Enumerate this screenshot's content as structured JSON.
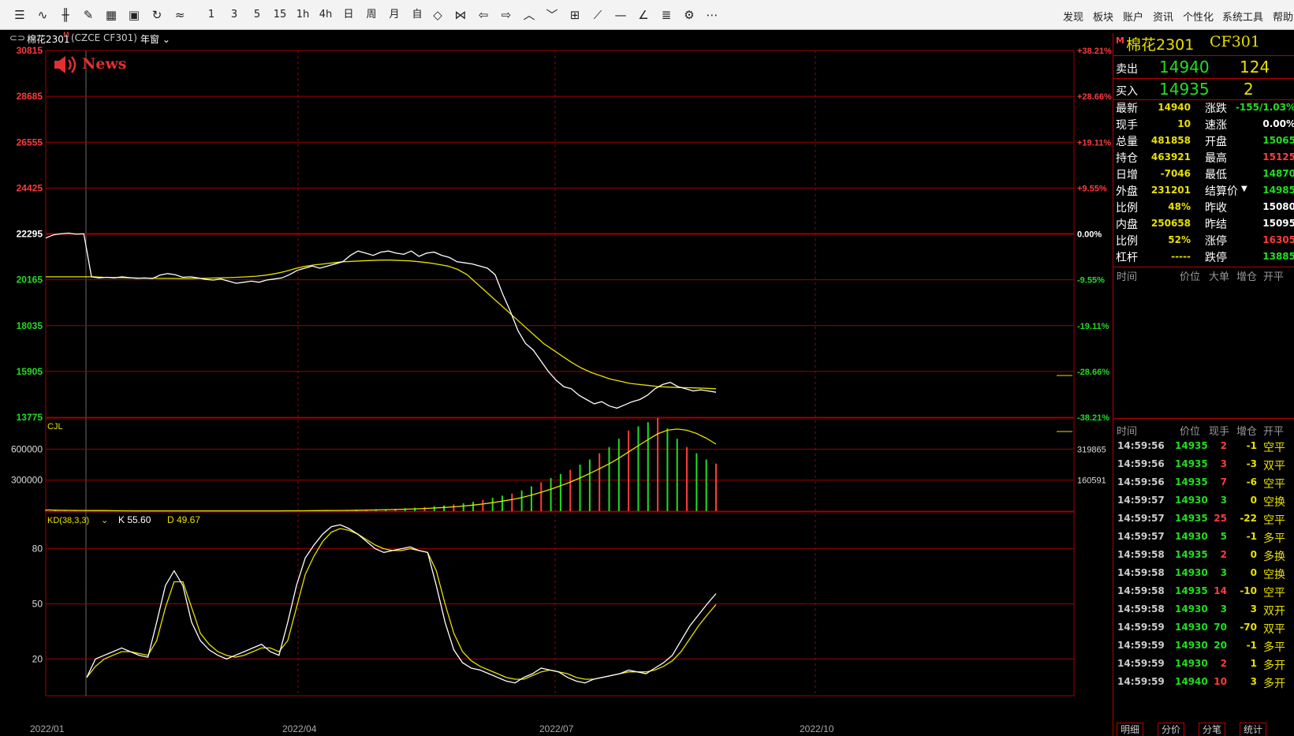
{
  "toolbar": {
    "buttons": [
      {
        "icon": "list-icon",
        "glyph": "☰"
      },
      {
        "icon": "line-chart-icon",
        "glyph": "∿"
      },
      {
        "icon": "candle-icon",
        "glyph": "╫"
      },
      {
        "icon": "draw-icon",
        "glyph": "✎"
      },
      {
        "icon": "grid-icon",
        "glyph": "▦"
      },
      {
        "icon": "save-icon",
        "glyph": "▣"
      },
      {
        "icon": "refresh-icon",
        "glyph": "↻"
      },
      {
        "icon": "wave-icon",
        "glyph": "≈"
      }
    ],
    "periods": [
      "1",
      "3",
      "5",
      "15",
      "1h",
      "4h",
      "日",
      "周",
      "月",
      "自"
    ],
    "tools": [
      {
        "icon": "zoom-in-icon",
        "glyph": "◇"
      },
      {
        "icon": "zoom-out-icon",
        "glyph": "⋈"
      },
      {
        "icon": "arrow-left-icon",
        "glyph": "⇦"
      },
      {
        "icon": "arrow-right-icon",
        "glyph": "⇨"
      },
      {
        "icon": "chevron-up-icon",
        "glyph": "︿"
      },
      {
        "icon": "chevron-down-icon",
        "glyph": "﹀"
      },
      {
        "icon": "layout-icon",
        "glyph": "⊞"
      },
      {
        "icon": "diagonal-line-icon",
        "glyph": "⟋"
      },
      {
        "icon": "horizontal-line-icon",
        "glyph": "—"
      },
      {
        "icon": "angle-icon",
        "glyph": "∠"
      },
      {
        "icon": "text-icon",
        "glyph": "≣"
      },
      {
        "icon": "settings-icon",
        "glyph": "⚙"
      },
      {
        "icon": "more-icon",
        "glyph": "⋯"
      }
    ],
    "menu": [
      "发现",
      "板块",
      "账户",
      "资讯",
      "个性化",
      "系统工具",
      "帮助"
    ]
  },
  "chart_header": {
    "name": "棉花2301",
    "marker": "M",
    "code": "(CZCE CF301)",
    "window": "年窗"
  },
  "news_label": "News",
  "colors": {
    "up": "#ff3b3b",
    "down": "#22dd22",
    "price_line": "#ffffff",
    "ma_line": "#e8e000",
    "grid": "#a00000",
    "label_yellow": "#e8e000"
  },
  "chart_data": {
    "type": "line",
    "x_labels": [
      "2022/01",
      "2022/04",
      "2022/07",
      "2022/10"
    ],
    "price_axis": {
      "left": [
        "30815",
        "28685",
        "26555",
        "24425",
        "22295",
        "20165",
        "18035",
        "15905",
        "13775"
      ],
      "right": [
        "+38.21%",
        "+28.66%",
        "+19.11%",
        "+9.55%",
        "0.00%",
        "-9.55%",
        "-19.11%",
        "-28.66%",
        "-38.21%"
      ],
      "ylim": [
        13775,
        30815
      ],
      "base": 22295
    },
    "price_series": [
      22100,
      22250,
      22300,
      22330,
      22280,
      22300,
      20300,
      20250,
      20280,
      20250,
      20300,
      20260,
      20230,
      20250,
      20220,
      20380,
      20450,
      20400,
      20280,
      20300,
      20250,
      20180,
      20150,
      20200,
      20100,
      20000,
      20050,
      20100,
      20050,
      20150,
      20200,
      20250,
      20400,
      20600,
      20700,
      20800,
      20700,
      20800,
      20900,
      21000,
      21300,
      21500,
      21400,
      21300,
      21450,
      21500,
      21400,
      21350,
      21500,
      21250,
      21400,
      21450,
      21300,
      21200,
      21000,
      20950,
      20900,
      20800,
      20700,
      20400,
      19500,
      18700,
      17800,
      17200,
      16900,
      16400,
      15900,
      15500,
      15200,
      15100,
      14800,
      14600,
      14400,
      14500,
      14300,
      14200,
      14350,
      14500,
      14600,
      14800,
      15100,
      15300,
      15400,
      15200,
      15100,
      15000,
      15050,
      15000,
      14940
    ],
    "ma_series": [
      20300,
      20300,
      20300,
      20300,
      20300,
      20300,
      20280,
      20270,
      20260,
      20250,
      20240,
      20240,
      20230,
      20230,
      20220,
      20220,
      20230,
      20240,
      20250,
      20260,
      20280,
      20300,
      20330,
      20380,
      20450,
      20550,
      20680,
      20780,
      20850,
      20900,
      20950,
      21000,
      21020,
      21040,
      21060,
      21080,
      21080,
      21060,
      21040,
      21000,
      20950,
      20880,
      20800,
      20650,
      20400,
      20000,
      19600,
      19200,
      18800,
      18400,
      18000,
      17600,
      17200,
      16900,
      16600,
      16300,
      16050,
      15850,
      15700,
      15550,
      15450,
      15350,
      15300,
      15250,
      15200,
      15180,
      15160,
      15150,
      15140,
      15120,
      15100
    ],
    "volume": {
      "label": "CJL",
      "axis_left": [
        "600000",
        "300000"
      ],
      "axis_right": [
        "319865",
        "160591"
      ],
      "ylim": [
        0,
        900000
      ],
      "values": [
        12000,
        8000,
        6000,
        5000,
        4000,
        3000,
        3000,
        3000,
        3000,
        3000,
        3000,
        3000,
        3000,
        3000,
        3000,
        3000,
        3000,
        3000,
        3000,
        3000,
        3000,
        3000,
        4000,
        4000,
        4000,
        5000,
        5000,
        6000,
        8000,
        9000,
        10000,
        12000,
        14000,
        16000,
        18000,
        20000,
        24000,
        28000,
        34000,
        40000,
        48000,
        56000,
        66000,
        76000,
        90000,
        110000,
        130000,
        150000,
        170000,
        200000,
        240000,
        280000,
        320000,
        360000,
        400000,
        450000,
        500000,
        560000,
        620000,
        700000,
        780000,
        820000,
        860000,
        900000,
        800000,
        700000,
        620000,
        560000,
        500000,
        460000
      ]
    },
    "kd": {
      "label": "KD(38,3,3)",
      "k_label": "K 55.60",
      "d_label": "D 49.67",
      "axis": [
        "80",
        "50",
        "20"
      ],
      "ylim": [
        0,
        100
      ],
      "k_series": [
        10,
        20,
        22,
        24,
        26,
        24,
        22,
        21,
        40,
        60,
        68,
        60,
        40,
        30,
        25,
        22,
        20,
        22,
        24,
        26,
        28,
        24,
        22,
        40,
        60,
        75,
        82,
        88,
        92,
        93,
        91,
        88,
        84,
        80,
        78,
        79,
        80,
        81,
        79,
        78,
        60,
        40,
        25,
        18,
        15,
        14,
        12,
        10,
        8,
        7,
        10,
        12,
        15,
        14,
        13,
        10,
        8,
        7,
        9,
        10,
        11,
        12,
        14,
        13,
        12,
        15,
        18,
        22,
        30,
        38,
        44,
        50,
        55.6
      ],
      "d_series": [
        10,
        16,
        20,
        22,
        24,
        24,
        23,
        22,
        30,
        48,
        62,
        62,
        48,
        34,
        28,
        24,
        22,
        21,
        22,
        24,
        26,
        26,
        24,
        30,
        48,
        66,
        76,
        84,
        89,
        91,
        90,
        88,
        85,
        82,
        80,
        79,
        79,
        80,
        79,
        78,
        68,
        50,
        34,
        24,
        19,
        16,
        14,
        12,
        10,
        9,
        9,
        11,
        13,
        14,
        13,
        12,
        10,
        9,
        9,
        10,
        11,
        12,
        13,
        13,
        13,
        14,
        16,
        19,
        24,
        31,
        38,
        44,
        49.67
      ]
    }
  },
  "quote": {
    "marker": "M",
    "title": "棉花2301",
    "code": "CF301",
    "sell_label": "卖出",
    "sell_price": "14940",
    "sell_qty": "124",
    "buy_label": "买入",
    "buy_price": "14935",
    "buy_qty": "2",
    "rows": [
      {
        "l1": "最新",
        "v1": "14940",
        "c1": "#e8e000",
        "l2": "涨跌",
        "v2": "-155/1.03%",
        "c2": "#22dd22"
      },
      {
        "l1": "现手",
        "v1": "10",
        "c1": "#e8e000",
        "l2": "速涨",
        "v2": "0.00%",
        "c2": "#ffffff"
      },
      {
        "l1": "总量",
        "v1": "481858",
        "c1": "#e8e000",
        "l2": "开盘",
        "v2": "15065",
        "c2": "#22dd22"
      },
      {
        "l1": "持仓",
        "v1": "463921",
        "c1": "#e8e000",
        "l2": "最高",
        "v2": "15125",
        "c2": "#ff3b3b"
      },
      {
        "l1": "日增",
        "v1": "-7046",
        "c1": "#e8e000",
        "l2": "最低",
        "v2": "14870",
        "c2": "#22dd22"
      },
      {
        "l1": "外盘",
        "v1": "231201",
        "c1": "#e8e000",
        "l2": "结算价",
        "v2": "14985",
        "c2": "#22dd22"
      },
      {
        "l1": "比例",
        "v1": "48%",
        "c1": "#e8e000",
        "l2": "昨收",
        "v2": "15080",
        "c2": "#ffffff"
      },
      {
        "l1": "内盘",
        "v1": "250658",
        "c1": "#e8e000",
        "l2": "昨结",
        "v2": "15095",
        "c2": "#ffffff"
      },
      {
        "l1": "比例",
        "v1": "52%",
        "c1": "#e8e000",
        "l2": "涨停",
        "v2": "16305",
        "c2": "#ff3b3b"
      },
      {
        "l1": "杠杆",
        "v1": "-----",
        "c1": "#e8e000",
        "l2": "跌停",
        "v2": "13885",
        "c2": "#22dd22"
      }
    ],
    "big_header": [
      "时间",
      "价位",
      "大单",
      "增仓",
      "开平"
    ],
    "tick_header": [
      "时间",
      "价位",
      "现手",
      "增仓",
      "开平"
    ],
    "ticks": [
      {
        "t": "14:59:56",
        "p": "14935",
        "v": "2",
        "vc": "#ff3b3b",
        "z": "-1",
        "k": "空平"
      },
      {
        "t": "14:59:56",
        "p": "14935",
        "v": "3",
        "vc": "#ff3b3b",
        "z": "-3",
        "k": "双平"
      },
      {
        "t": "14:59:56",
        "p": "14935",
        "v": "7",
        "vc": "#ff3b3b",
        "z": "-6",
        "k": "空平"
      },
      {
        "t": "14:59:57",
        "p": "14930",
        "v": "3",
        "vc": "#22dd22",
        "z": "0",
        "k": "空换"
      },
      {
        "t": "14:59:57",
        "p": "14935",
        "v": "25",
        "vc": "#ff3b3b",
        "z": "-22",
        "k": "空平"
      },
      {
        "t": "14:59:57",
        "p": "14930",
        "v": "5",
        "vc": "#22dd22",
        "z": "-1",
        "k": "多平"
      },
      {
        "t": "14:59:58",
        "p": "14935",
        "v": "2",
        "vc": "#ff3b3b",
        "z": "0",
        "k": "多换"
      },
      {
        "t": "14:59:58",
        "p": "14930",
        "v": "3",
        "vc": "#22dd22",
        "z": "0",
        "k": "空换"
      },
      {
        "t": "14:59:58",
        "p": "14935",
        "v": "14",
        "vc": "#ff3b3b",
        "z": "-10",
        "k": "空平"
      },
      {
        "t": "14:59:58",
        "p": "14930",
        "v": "3",
        "vc": "#22dd22",
        "z": "3",
        "k": "双开"
      },
      {
        "t": "14:59:59",
        "p": "14930",
        "v": "70",
        "vc": "#22dd22",
        "z": "-70",
        "k": "双平"
      },
      {
        "t": "14:59:59",
        "p": "14930",
        "v": "20",
        "vc": "#22dd22",
        "z": "-1",
        "k": "多平"
      },
      {
        "t": "14:59:59",
        "p": "14930",
        "v": "2",
        "vc": "#ff3b3b",
        "z": "1",
        "k": "多开"
      },
      {
        "t": "14:59:59",
        "p": "14940",
        "v": "10",
        "vc": "#ff3b3b",
        "z": "3",
        "k": "多开"
      }
    ],
    "tabs": [
      "明细",
      "分价",
      "分笔",
      "统计"
    ]
  }
}
